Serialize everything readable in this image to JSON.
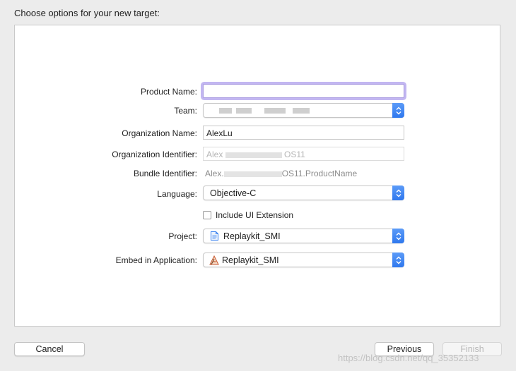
{
  "dialog": {
    "heading": "Choose options for your new target:"
  },
  "form": {
    "product_name": {
      "label": "Product Name:",
      "value": ""
    },
    "team": {
      "label": "Team:",
      "value": ""
    },
    "organization_name": {
      "label": "Organization Name:",
      "value": "AlexLu"
    },
    "organization_identifier": {
      "label": "Organization Identifier:",
      "value_start": "Alex",
      "value_end": "OS11"
    },
    "bundle_identifier": {
      "label": "Bundle Identifier:",
      "value_start": "Alex.",
      "value_end": "OS11.ProductName"
    },
    "language": {
      "label": "Language:",
      "value": "Objective-C"
    },
    "include_ui_extension": {
      "label": "Include UI Extension",
      "checked": false
    },
    "project": {
      "label": "Project:",
      "value": "Replaykit_SMI"
    },
    "embed_in_application": {
      "label": "Embed in Application:",
      "value": "Replaykit_SMI"
    }
  },
  "buttons": {
    "cancel": "Cancel",
    "previous": "Previous",
    "finish": "Finish"
  },
  "watermark": "https://blog.csdn.net/qq_35352133",
  "colors": {
    "accent": "#3a82f0",
    "focus_ring": "#8f7ae6"
  }
}
